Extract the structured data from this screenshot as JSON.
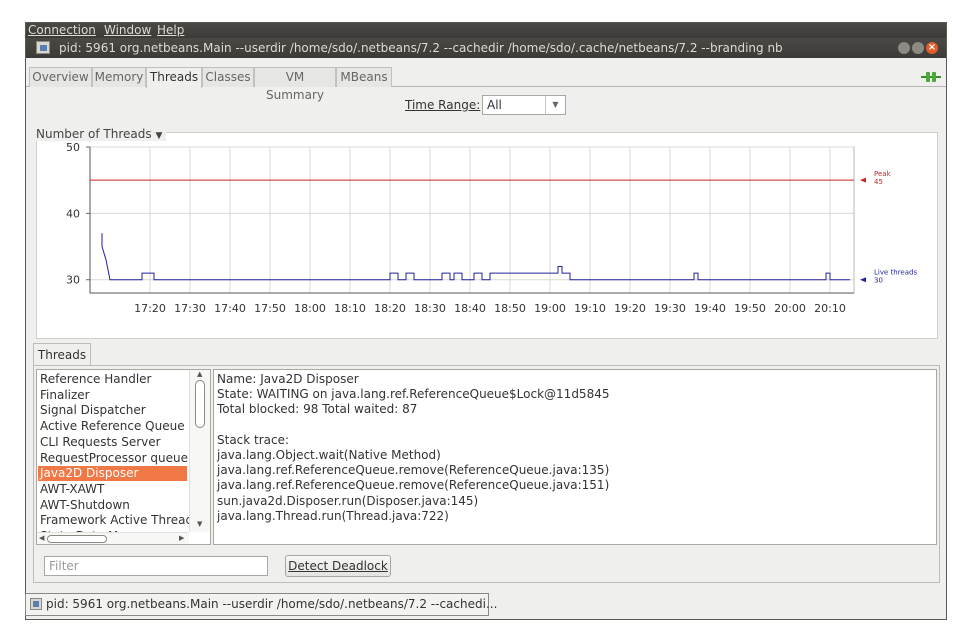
{
  "menu": [
    "Connection",
    "Window",
    "Help"
  ],
  "window_title": "pid: 5961 org.netbeans.Main --userdir /home/sdo/.netbeans/7.2 --cachedir /home/sdo/.cache/netbeans/7.2 --branding nb",
  "tabs": [
    "Overview",
    "Memory",
    "Threads",
    "Classes",
    "VM Summary",
    "MBeans"
  ],
  "active_tab": "Threads",
  "time_range": {
    "label": "Time Range:",
    "value": "All"
  },
  "chart_title": "Number of Threads",
  "chart_data": {
    "type": "line",
    "title": "Number of Threads",
    "ylim": [
      28,
      50
    ],
    "yticks": [
      30,
      40,
      50
    ],
    "xticks": [
      "17:20",
      "17:30",
      "17:40",
      "17:50",
      "18:00",
      "18:10",
      "18:20",
      "18:30",
      "18:40",
      "18:50",
      "19:00",
      "19:10",
      "19:20",
      "19:30",
      "19:40",
      "19:50",
      "20:00",
      "20:10"
    ],
    "grid": true,
    "series": [
      {
        "name": "Peak",
        "color": "#cc2222",
        "value": 45
      },
      {
        "name": "Live threads",
        "color": "#22229c",
        "value": 30,
        "x": [
          "17:08",
          "17:08",
          "17:09",
          "17:10",
          "17:11",
          "17:18",
          "17:18",
          "17:21",
          "17:21",
          "18:20",
          "18:20",
          "18:22",
          "18:22",
          "18:24",
          "18:24",
          "18:26",
          "18:26",
          "18:33",
          "18:33",
          "18:35",
          "18:35",
          "18:36",
          "18:36",
          "18:38",
          "18:38",
          "18:41",
          "18:41",
          "18:43",
          "18:43",
          "18:45",
          "18:45",
          "19:02",
          "19:02",
          "19:03",
          "19:03",
          "19:05",
          "19:05",
          "19:36",
          "19:36",
          "19:37",
          "19:37",
          "20:09",
          "20:09",
          "20:10",
          "20:10",
          "20:15"
        ],
        "y": [
          37,
          35,
          33,
          30,
          30,
          30,
          31,
          31,
          30,
          30,
          31,
          31,
          30,
          30,
          31,
          31,
          30,
          30,
          31,
          31,
          30,
          30,
          31,
          31,
          30,
          30,
          31,
          31,
          30,
          30,
          31,
          31,
          32,
          32,
          31,
          31,
          30,
          30,
          31,
          31,
          30,
          30,
          31,
          31,
          30,
          30
        ]
      }
    ],
    "legend_labels": {
      "peak": {
        "name": "Peak",
        "value": "45"
      },
      "live": {
        "name": "Live threads",
        "value": "30"
      }
    }
  },
  "threads_tab_label": "Threads",
  "thread_list": [
    "Reference Handler",
    "Finalizer",
    "Signal Dispatcher",
    "Active Reference Queue D",
    "CLI Requests Server",
    "RequestProcessor queue",
    "Java2D Disposer",
    "AWT-XAWT",
    "AWT-Shutdown",
    "Framework Active Thread",
    "State Data Manager"
  ],
  "selected_thread": "Java2D Disposer",
  "thread_details": [
    "Name: Java2D Disposer",
    "State: WAITING on java.lang.ref.ReferenceQueue$Lock@11d5845",
    "Total blocked: 98  Total waited: 87",
    "",
    "Stack trace:",
    "java.lang.Object.wait(Native Method)",
    "java.lang.ref.ReferenceQueue.remove(ReferenceQueue.java:135)",
    "java.lang.ref.ReferenceQueue.remove(ReferenceQueue.java:151)",
    "sun.java2d.Disposer.run(Disposer.java:145)",
    "java.lang.Thread.run(Thread.java:722)"
  ],
  "filter_placeholder": "Filter",
  "detect_deadlock_label": "Detect Deadlock",
  "taskbar_label": "pid: 5961 org.netbeans.Main --userdir /home/sdo/.netbeans/7.2 --cachedi..."
}
